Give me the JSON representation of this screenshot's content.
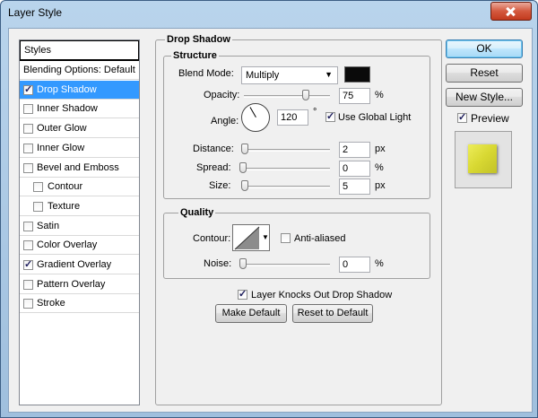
{
  "window": {
    "title": "Layer Style"
  },
  "sidebar": {
    "header": "Styles",
    "items": [
      {
        "label": "Blending Options: Default",
        "checkbox": false,
        "checked": false,
        "indent": false,
        "selected": false
      },
      {
        "label": "Drop Shadow",
        "checkbox": true,
        "checked": true,
        "indent": false,
        "selected": true
      },
      {
        "label": "Inner Shadow",
        "checkbox": true,
        "checked": false,
        "indent": false,
        "selected": false
      },
      {
        "label": "Outer Glow",
        "checkbox": true,
        "checked": false,
        "indent": false,
        "selected": false
      },
      {
        "label": "Inner Glow",
        "checkbox": true,
        "checked": false,
        "indent": false,
        "selected": false
      },
      {
        "label": "Bevel and Emboss",
        "checkbox": true,
        "checked": false,
        "indent": false,
        "selected": false
      },
      {
        "label": "Contour",
        "checkbox": true,
        "checked": false,
        "indent": true,
        "selected": false
      },
      {
        "label": "Texture",
        "checkbox": true,
        "checked": false,
        "indent": true,
        "selected": false
      },
      {
        "label": "Satin",
        "checkbox": true,
        "checked": false,
        "indent": false,
        "selected": false
      },
      {
        "label": "Color Overlay",
        "checkbox": true,
        "checked": false,
        "indent": false,
        "selected": false
      },
      {
        "label": "Gradient Overlay",
        "checkbox": true,
        "checked": true,
        "indent": false,
        "selected": false
      },
      {
        "label": "Pattern Overlay",
        "checkbox": true,
        "checked": false,
        "indent": false,
        "selected": false
      },
      {
        "label": "Stroke",
        "checkbox": true,
        "checked": false,
        "indent": false,
        "selected": false
      }
    ]
  },
  "drop_shadow": {
    "title": "Drop Shadow",
    "structure": {
      "title": "Structure",
      "blend_mode_label": "Blend Mode:",
      "blend_mode_value": "Multiply",
      "shadow_color": "#0a0a0a",
      "opacity_label": "Opacity:",
      "opacity_value": "75",
      "opacity_unit": "%",
      "opacity_level": 0.75,
      "angle_label": "Angle:",
      "angle_value": "120",
      "angle_degrees": 120,
      "angle_unit": "°",
      "global_light_label": "Use Global Light",
      "global_light_checked": true,
      "distance_label": "Distance:",
      "distance_value": "2",
      "distance_unit": "px",
      "spread_label": "Spread:",
      "spread_value": "0",
      "spread_unit": "%",
      "size_label": "Size:",
      "size_value": "5",
      "size_unit": "px"
    },
    "quality": {
      "title": "Quality",
      "contour_label": "Contour:",
      "anti_aliased_label": "Anti-aliased",
      "anti_aliased_checked": false,
      "noise_label": "Noise:",
      "noise_value": "0",
      "noise_unit": "%"
    },
    "knocks_out_label": "Layer Knocks Out Drop Shadow",
    "knocks_out_checked": true,
    "make_default_label": "Make Default",
    "reset_default_label": "Reset to Default"
  },
  "actions": {
    "ok_label": "OK",
    "reset_label": "Reset",
    "new_style_label": "New Style...",
    "preview_label": "Preview",
    "preview_checked": true,
    "preview_swatch_color": "#d8d832"
  }
}
